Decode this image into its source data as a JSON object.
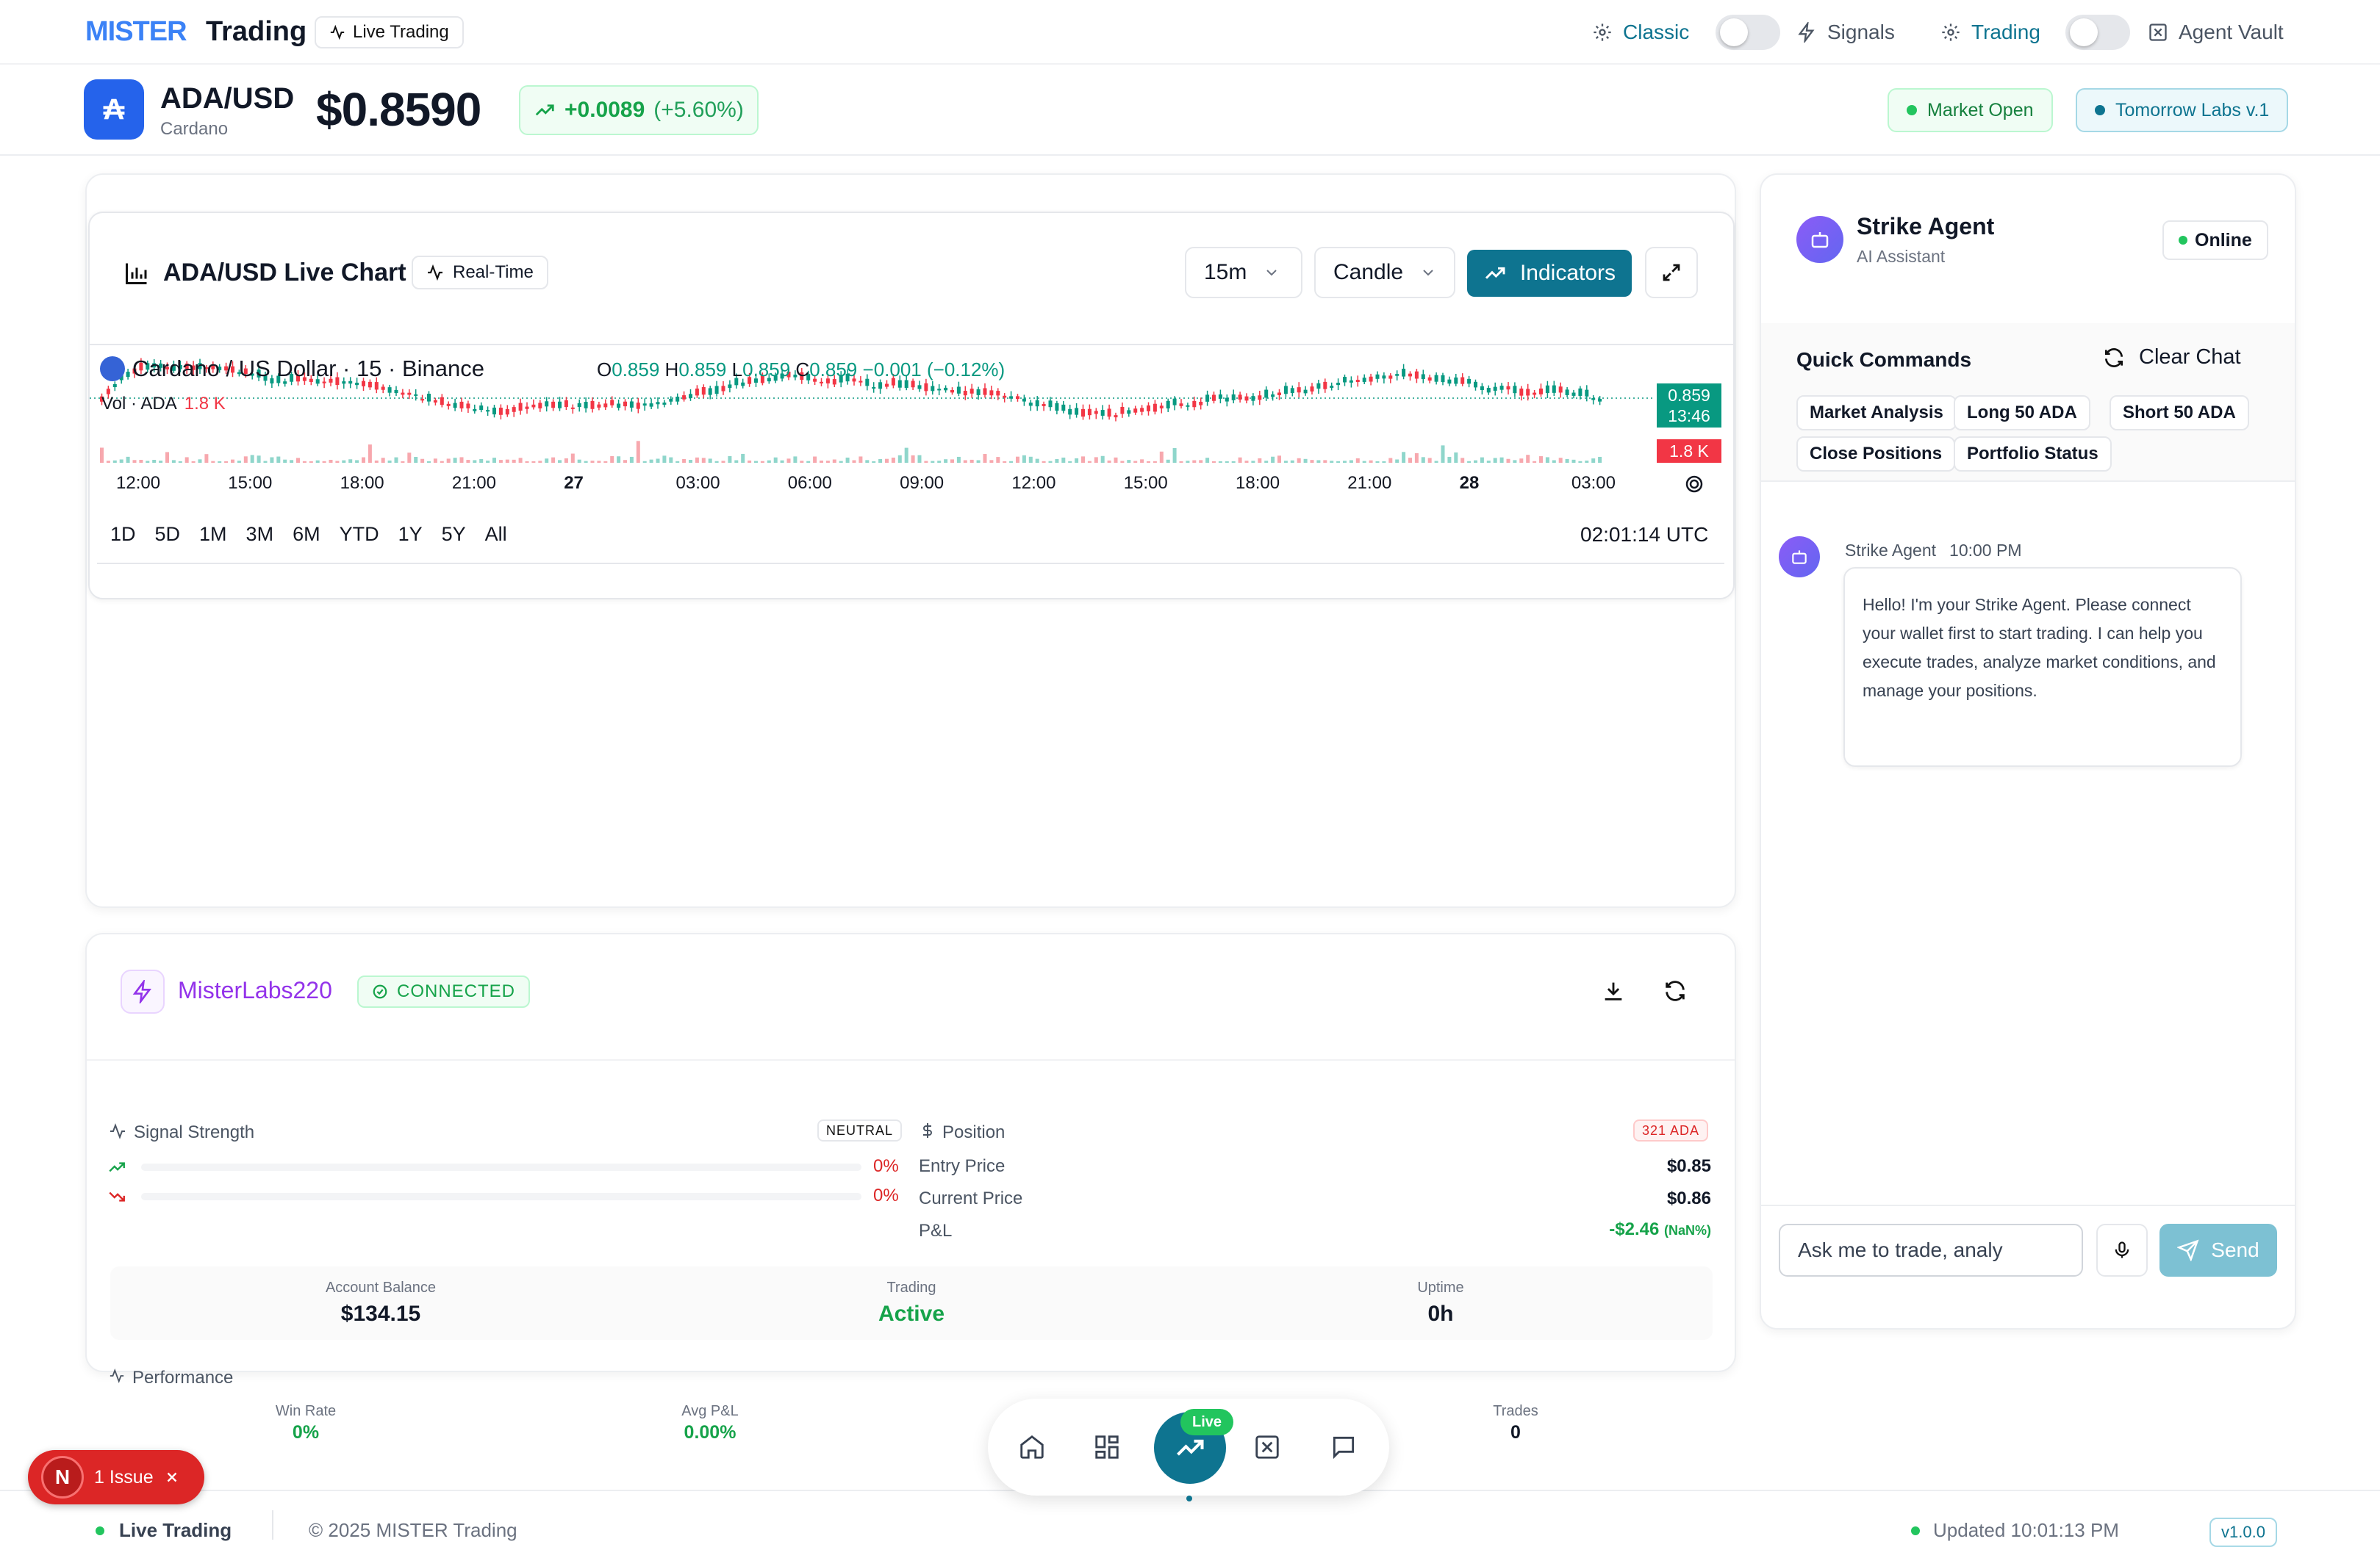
{
  "nav": {
    "brand_a": "MISTER",
    "brand_b": "Trading",
    "live_badge": "Live Trading",
    "classic": "Classic",
    "signals": "Signals",
    "trading": "Trading",
    "vault": "Agent Vault"
  },
  "ticker": {
    "logo": "₳",
    "pair": "ADA/USD",
    "name": "Cardano",
    "price": "$0.8590",
    "change": "+0.0089",
    "change_pct": "(+5.60%)",
    "market": "Market Open",
    "version": "Tomorrow Labs v.1"
  },
  "chart": {
    "title": "ADA/USD Live Chart",
    "realtime": "Real-Time",
    "interval": "15m",
    "style": "Candle",
    "indicators": "Indicators",
    "legend": "Cardano / US Dollar · 15 · Binance",
    "ohlc_o": "O",
    "o": "0.859",
    "ohlc_h": "H",
    "h": "0.859",
    "ohlc_l": "L",
    "l": "0.859",
    "ohlc_c": "C",
    "c": "0.859",
    "delta": "−0.001 (−0.12%)",
    "vol_label": "Vol · ADA",
    "vol_value": "1.8 K",
    "last_price": "0.859",
    "countdown": "13:46",
    "vol_tag": "1.8 K",
    "time_ticks": [
      "12:00",
      "15:00",
      "18:00",
      "21:00",
      "27",
      "03:00",
      "06:00",
      "09:00",
      "12:00",
      "15:00",
      "18:00",
      "21:00",
      "28",
      "03:00"
    ],
    "ranges": [
      "1D",
      "5D",
      "1M",
      "3M",
      "6M",
      "YTD",
      "1Y",
      "5Y",
      "All"
    ],
    "clock": "02:01:14 UTC"
  },
  "bot": {
    "name": "MisterLabs220",
    "status": "CONNECTED",
    "signal_label": "Signal Strength",
    "signal_tag": "NEUTRAL",
    "up_pct": "0%",
    "down_pct": "0%",
    "position_label": "Position",
    "position_tag": "321 ADA",
    "entry_label": "Entry Price",
    "entry": "$0.85",
    "current_label": "Current Price",
    "current": "$0.86",
    "pnl_label": "P&L",
    "pnl": "-$2.46",
    "pnl_pct": "(NaN%)",
    "balance_label": "Account Balance",
    "balance": "$134.15",
    "trading_label": "Trading",
    "trading": "Active",
    "uptime_label": "Uptime",
    "uptime": "0h"
  },
  "performance": {
    "title": "Performance",
    "win_label": "Win Rate",
    "win": "0%",
    "avg_label": "Avg P&L",
    "avg": "0.00%",
    "trades_label": "Trades",
    "trades": "0"
  },
  "agent": {
    "name": "Strike Agent",
    "role": "AI Assistant",
    "status": "Online",
    "quick_title": "Quick Commands",
    "clear": "Clear Chat",
    "commands": [
      "Market Analysis",
      "Long 50 ADA",
      "Short 50 ADA",
      "Close Positions",
      "Portfolio Status"
    ],
    "msg_author": "Strike Agent",
    "msg_time": "10:00 PM",
    "message": "Hello! I'm your Strike Agent. Please connect your wallet first to start trading. I can help you execute trades, analyze market conditions, and manage your positions.",
    "input_placeholder": "Ask me to trade, analy",
    "send": "Send"
  },
  "dock": {
    "live": "Live"
  },
  "issue": {
    "letter": "N",
    "label": "1 Issue"
  },
  "footer": {
    "left": "Live Trading",
    "copy": "© 2025 MISTER Trading",
    "updated": "Updated 10:01:13 PM",
    "ver": "v1.0.0"
  },
  "colors": {
    "accent": "#0e7490",
    "up": "#089981",
    "down": "#f23645",
    "purple": "#9333ea"
  }
}
